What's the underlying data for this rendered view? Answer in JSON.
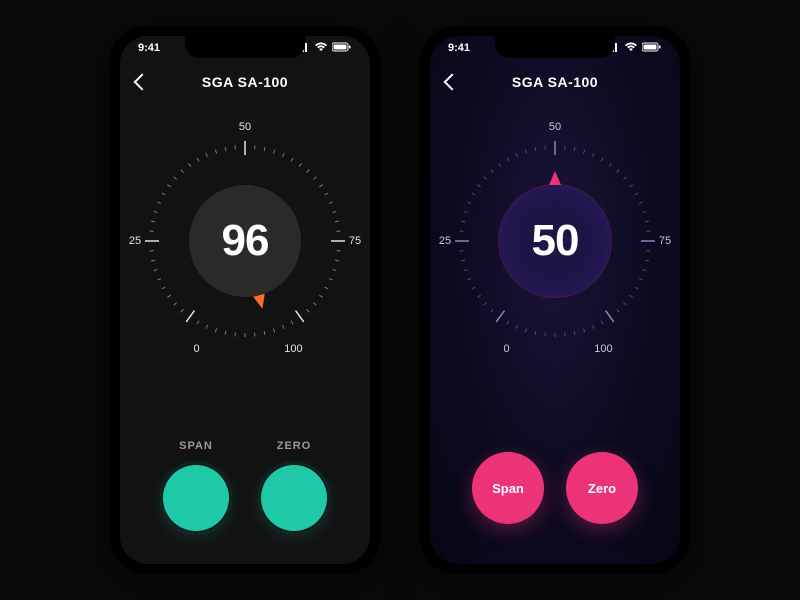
{
  "status": {
    "time": "9:41"
  },
  "variant_a": {
    "title": "SGA SA-100",
    "value": "96",
    "ticks": {
      "t0": "0",
      "t25": "25",
      "t50": "50",
      "t75": "75",
      "t100": "100"
    },
    "buttons": {
      "span": "SPAN",
      "zero": "ZERO"
    },
    "accent": "#1fc9a8",
    "pointer_color": "#ff6b2d",
    "pointer_angle_deg": 165.6
  },
  "variant_b": {
    "title": "SGA SA-100",
    "value": "50",
    "ticks": {
      "t0": "0",
      "t25": "25",
      "t50": "50",
      "t75": "75",
      "t100": "100"
    },
    "buttons": {
      "span": "Span",
      "zero": "Zero"
    },
    "accent": "#ec3377",
    "pointer_color": "#ec3377",
    "pointer_angle_deg": 0
  },
  "gauge": {
    "min": 0,
    "max": 100,
    "start_angle_deg": -180,
    "end_angle_deg": 180
  }
}
